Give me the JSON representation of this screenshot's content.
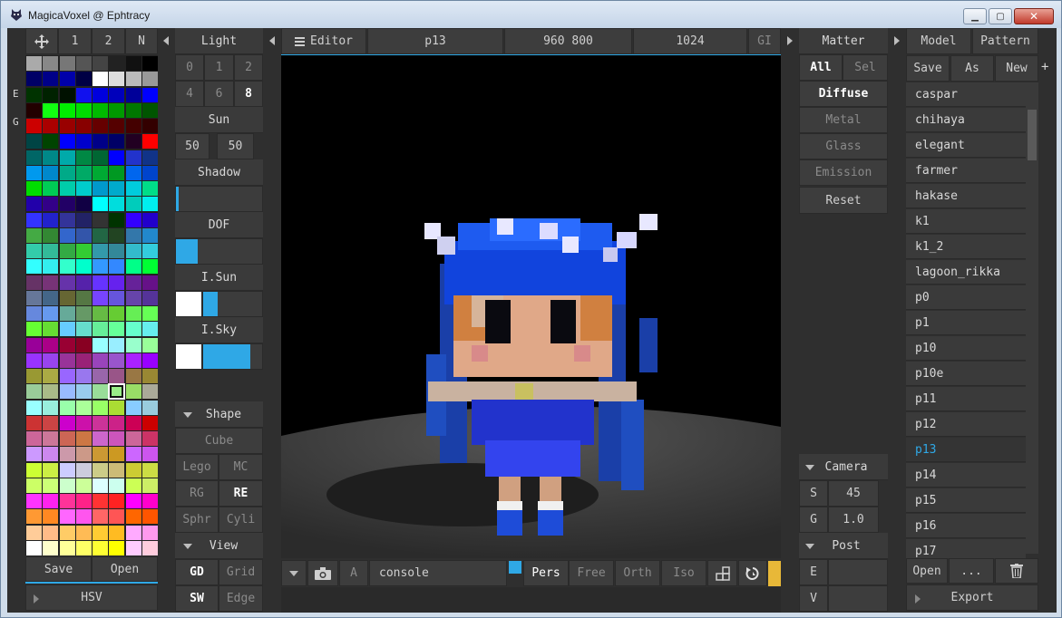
{
  "window": {
    "title": "MagicaVoxel @ Ephtracy",
    "minimize": "▁",
    "maximize": "▢",
    "close": "✕"
  },
  "colors": {
    "accent": "#2fa8e6",
    "panel": "#3a3a3a",
    "background": "#2f2f2f"
  },
  "palette_panel": {
    "tool_icon": "move-icon",
    "tabs": [
      "1",
      "2",
      "N"
    ],
    "side_letters": [
      "E",
      "G"
    ],
    "save": "Save",
    "open": "Open",
    "hsv": "HSV",
    "colors": [
      [
        "#aaaaaa",
        "#888888",
        "#777777",
        "#555555",
        "#444444",
        "#222222",
        "#111111",
        "#000000"
      ],
      [
        "#000066",
        "#000088",
        "#0000aa",
        "#000044",
        "#ffffff",
        "#dddddd",
        "#bbbbbb",
        "#999999"
      ],
      [
        "#003300",
        "#002200",
        "#001100",
        "#1111ee",
        "#0000dd",
        "#0000bb",
        "#000099",
        "#0000ff"
      ],
      [
        "#220000",
        "#11ff11",
        "#00ee00",
        "#00dd00",
        "#00bb00",
        "#009900",
        "#007700",
        "#005500"
      ],
      [
        "#cc0000",
        "#aa0000",
        "#990000",
        "#880000",
        "#660000",
        "#550000",
        "#440000",
        "#330000"
      ],
      [
        "#004444",
        "#004400",
        "#0000ff",
        "#0000cc",
        "#000088",
        "#000066",
        "#220022",
        "#ff0000"
      ],
      [
        "#006666",
        "#008888",
        "#00aaaa",
        "#008844",
        "#006633",
        "#0000ff",
        "#2233cc",
        "#113388"
      ],
      [
        "#0099ee",
        "#0088cc",
        "#00aa88",
        "#00aa66",
        "#00aa33",
        "#009922",
        "#0066ee",
        "#0044cc"
      ],
      [
        "#00dd00",
        "#00cc55",
        "#00ccaa",
        "#00cccc",
        "#0099cc",
        "#00aacc",
        "#00ccdd",
        "#00dd88"
      ],
      [
        "#2200aa",
        "#330088",
        "#220066",
        "#110044",
        "#00ffff",
        "#00dddd",
        "#00ccbb",
        "#00eeee"
      ],
      [
        "#3333ff",
        "#2222cc",
        "#333399",
        "#222266",
        "#333333",
        "#003300",
        "#3300ff",
        "#2200cc"
      ],
      [
        "#44aa44",
        "#338833",
        "#3366cc",
        "#3355aa",
        "#226644",
        "#224422",
        "#3377aa",
        "#2288cc"
      ],
      [
        "#33ccaa",
        "#33bb99",
        "#33aa44",
        "#33cc33",
        "#3399aa",
        "#338899",
        "#33bbcc",
        "#33ccdd"
      ],
      [
        "#33ffff",
        "#33eeee",
        "#33ffcc",
        "#00ffcc",
        "#3399ff",
        "#3388ff",
        "#00ff88",
        "#00ff33"
      ],
      [
        "#663366",
        "#773377",
        "#6633aa",
        "#5522aa",
        "#6633ff",
        "#6622ee",
        "#662299",
        "#661188"
      ],
      [
        "#667799",
        "#446688",
        "#666633",
        "#557744",
        "#7744ff",
        "#6655dd",
        "#6644aa",
        "#553399"
      ],
      [
        "#6688dd",
        "#6699ee",
        "#66aa99",
        "#669966",
        "#66bb44",
        "#66cc33",
        "#66ee55",
        "#66ff55"
      ],
      [
        "#66ff33",
        "#66dd33",
        "#66ccff",
        "#66ddcc",
        "#66ee99",
        "#66ff99",
        "#66ffcc",
        "#66eeee"
      ],
      [
        "#990099",
        "#aa0088",
        "#990033",
        "#880022",
        "#99ffff",
        "#99eeff",
        "#99ffcc",
        "#99ff99"
      ],
      [
        "#9933ff",
        "#9944ee",
        "#993399",
        "#992277",
        "#9944bb",
        "#9955cc",
        "#aa22ff",
        "#9900ff"
      ],
      [
        "#999933",
        "#aaaa44",
        "#9966ff",
        "#9977ee",
        "#9966aa",
        "#995588",
        "#997744",
        "#998833"
      ],
      [
        "#99cc99",
        "#aabb88",
        "#99bbff",
        "#99ccee",
        "#99dd99",
        "#99ee88",
        "#99dd66",
        "#aaaa99"
      ],
      [
        "#99ffff",
        "#99eedd",
        "#99ffaa",
        "#aaff99",
        "#99ff66",
        "#aadd33",
        "#88ccff",
        "#99ccdd"
      ],
      [
        "#cc3333",
        "#cc4444",
        "#cc00cc",
        "#cc11aa",
        "#cc3399",
        "#cc2288",
        "#cc0055",
        "#cc0000"
      ],
      [
        "#cc6699",
        "#cc7799",
        "#cc6655",
        "#cc7744",
        "#cc66cc",
        "#cc55bb",
        "#cc6699",
        "#cc3366"
      ],
      [
        "#cc99ff",
        "#cc88ee",
        "#cc99aa",
        "#cc9988",
        "#cc9933",
        "#cc9922",
        "#cc66ff",
        "#cc55ee"
      ],
      [
        "#ccff33",
        "#ccee44",
        "#ccccff",
        "#ccccdd",
        "#cccc88",
        "#ccbb77",
        "#cccc33",
        "#ccdd44"
      ],
      [
        "#ccff66",
        "#ccff77",
        "#ccffcc",
        "#ccff99",
        "#ddffff",
        "#ccffee",
        "#ccff55",
        "#ccee66"
      ],
      [
        "#ff33ff",
        "#ff22ee",
        "#ff3399",
        "#ff2288",
        "#ff3333",
        "#ff2222",
        "#ff00ff",
        "#ff00cc"
      ],
      [
        "#ff9933",
        "#ff8822",
        "#ff66ff",
        "#ff55ee",
        "#ff6666",
        "#ff5555",
        "#ff6600",
        "#ff5500"
      ],
      [
        "#ffcc99",
        "#ffbb88",
        "#ffcc66",
        "#ffbb55",
        "#ffcc33",
        "#ffbb22",
        "#ffaaff",
        "#ff99ee"
      ],
      [
        "#ffffff",
        "#ffffcc",
        "#ffff99",
        "#ffff66",
        "#ffff33",
        "#ffff00",
        "#ffccff",
        "#ffccdd"
      ]
    ],
    "selected_row": 21,
    "selected_col": 5
  },
  "light_panel": {
    "title": "Light",
    "presets_row1": [
      "0",
      "1",
      "2"
    ],
    "presets_row2": [
      "4",
      "6",
      "8"
    ],
    "sun": "Sun",
    "sun_values": [
      "50",
      "50"
    ],
    "shadow": "Shadow",
    "shadow_level": 3,
    "dof": "DOF",
    "dof_level": 25,
    "i_sun": "I.Sun",
    "i_sun_level": 25,
    "i_sky": "I.Sky",
    "i_sky_level": 80,
    "shape": "Shape",
    "cube": "Cube",
    "lego": "Lego",
    "mc": "MC",
    "rg": "RG",
    "re": "RE",
    "sphr": "Sphr",
    "cyli": "Cyli",
    "view": "View",
    "gd": "GD",
    "grid": "Grid",
    "sw": "SW",
    "edge": "Edge"
  },
  "toolbar": {
    "editor": "Editor",
    "model_name": "p13",
    "resolution": "960 800",
    "samples": "1024",
    "gi": "GI"
  },
  "viewport_bar": {
    "a": "A",
    "console": "console",
    "pers": "Pers",
    "free": "Free",
    "orth": "Orth",
    "iso": "Iso"
  },
  "matter_panel": {
    "title": "Matter",
    "all": "All",
    "sel": "Sel",
    "diffuse": "Diffuse",
    "metal": "Metal",
    "glass": "Glass",
    "emission": "Emission",
    "reset": "Reset",
    "camera": "Camera",
    "s_label": "S",
    "s_value": "45",
    "g_label": "G",
    "g_value": "1.0",
    "post": "Post",
    "e_label": "E",
    "v_label": "V"
  },
  "model_panel": {
    "model_tab": "Model",
    "pattern_tab": "Pattern",
    "save": "Save",
    "as": "As",
    "new": "New",
    "plus": "+",
    "items": [
      "caspar",
      "chihaya",
      "elegant",
      "farmer",
      "hakase",
      "k1",
      "k1_2",
      "lagoon_rikka",
      "p0",
      "p1",
      "p10",
      "p10e",
      "p11",
      "p12",
      "p13",
      "p14",
      "p15",
      "p16",
      "p17"
    ],
    "selected": "p13",
    "open": "Open",
    "more": "...",
    "export": "Export"
  }
}
